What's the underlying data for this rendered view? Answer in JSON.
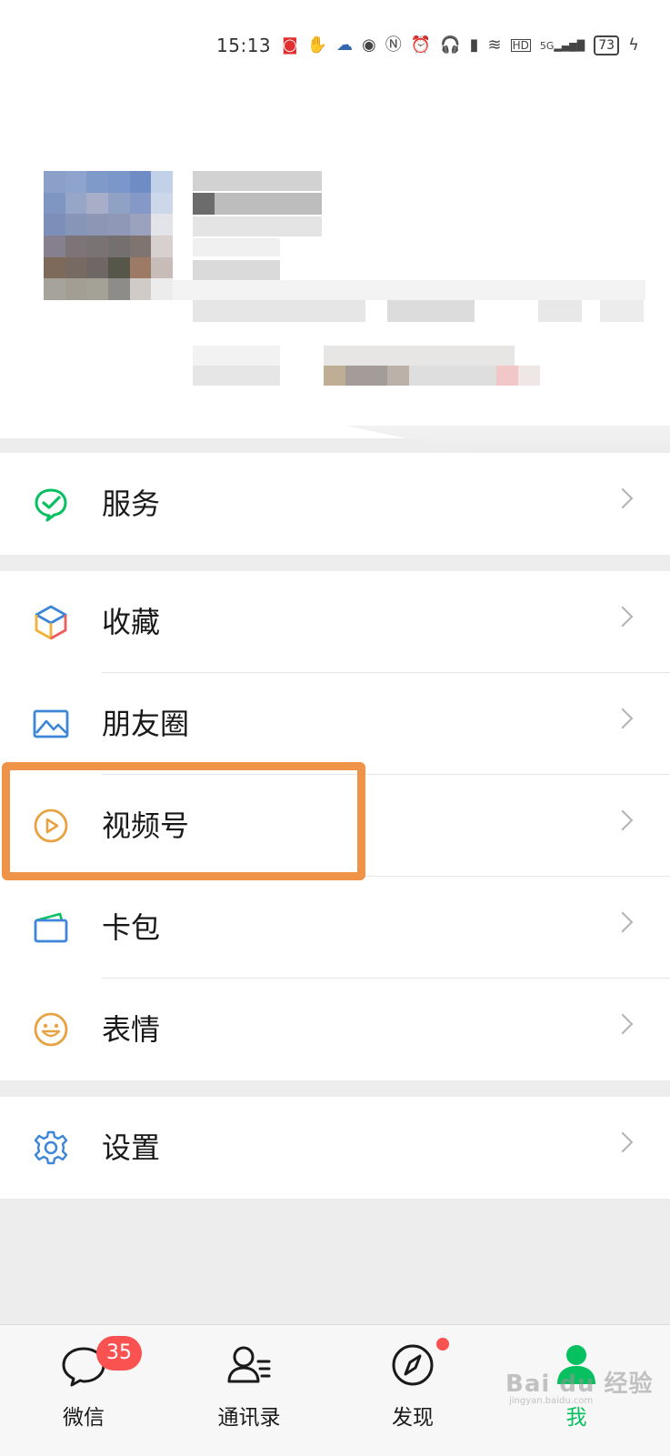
{
  "status_bar": {
    "time": "15:13",
    "network": "5G",
    "quality_badge": "HD",
    "battery": "73",
    "icons": [
      "app-notification-icon",
      "hand-icon",
      "cloud-icon",
      "eye-icon",
      "nfc-icon",
      "alarm-icon",
      "headphones-icon",
      "battery-small-icon",
      "wifi-icon",
      "hd-icon",
      "signal-icon",
      "battery-icon",
      "charging-icon"
    ]
  },
  "profile": {
    "avatar": "pixelated-avatar",
    "name": "",
    "id": "",
    "status": ""
  },
  "menu": {
    "group1": [
      {
        "label": "服务",
        "icon": "service-icon",
        "color": "#07c160"
      }
    ],
    "group2": [
      {
        "label": "收藏",
        "icon": "favorites-cube-icon"
      },
      {
        "label": "朋友圈",
        "icon": "moments-photo-icon",
        "color": "#3d86d8"
      },
      {
        "label": "视频号",
        "icon": "channels-play-icon",
        "color": "#e8a244",
        "highlighted": true
      },
      {
        "label": "卡包",
        "icon": "card-wallet-icon",
        "color": "#3d86d8"
      },
      {
        "label": "表情",
        "icon": "sticker-smile-icon",
        "color": "#e8a244"
      }
    ],
    "group3": [
      {
        "label": "设置",
        "icon": "settings-gear-icon",
        "color": "#3d86d8"
      }
    ]
  },
  "highlight_color": "#ef9348",
  "tabbar": {
    "tabs": [
      {
        "label": "微信",
        "icon": "chat-bubble-icon",
        "badge": "35"
      },
      {
        "label": "通讯录",
        "icon": "contacts-icon"
      },
      {
        "label": "发现",
        "icon": "discover-compass-icon",
        "dot": true
      },
      {
        "label": "我",
        "icon": "me-person-icon",
        "active": true
      }
    ],
    "active_color": "#07c160"
  },
  "watermark": {
    "text": "Bai du 经验",
    "sub": "jingyan.baidu.com"
  }
}
